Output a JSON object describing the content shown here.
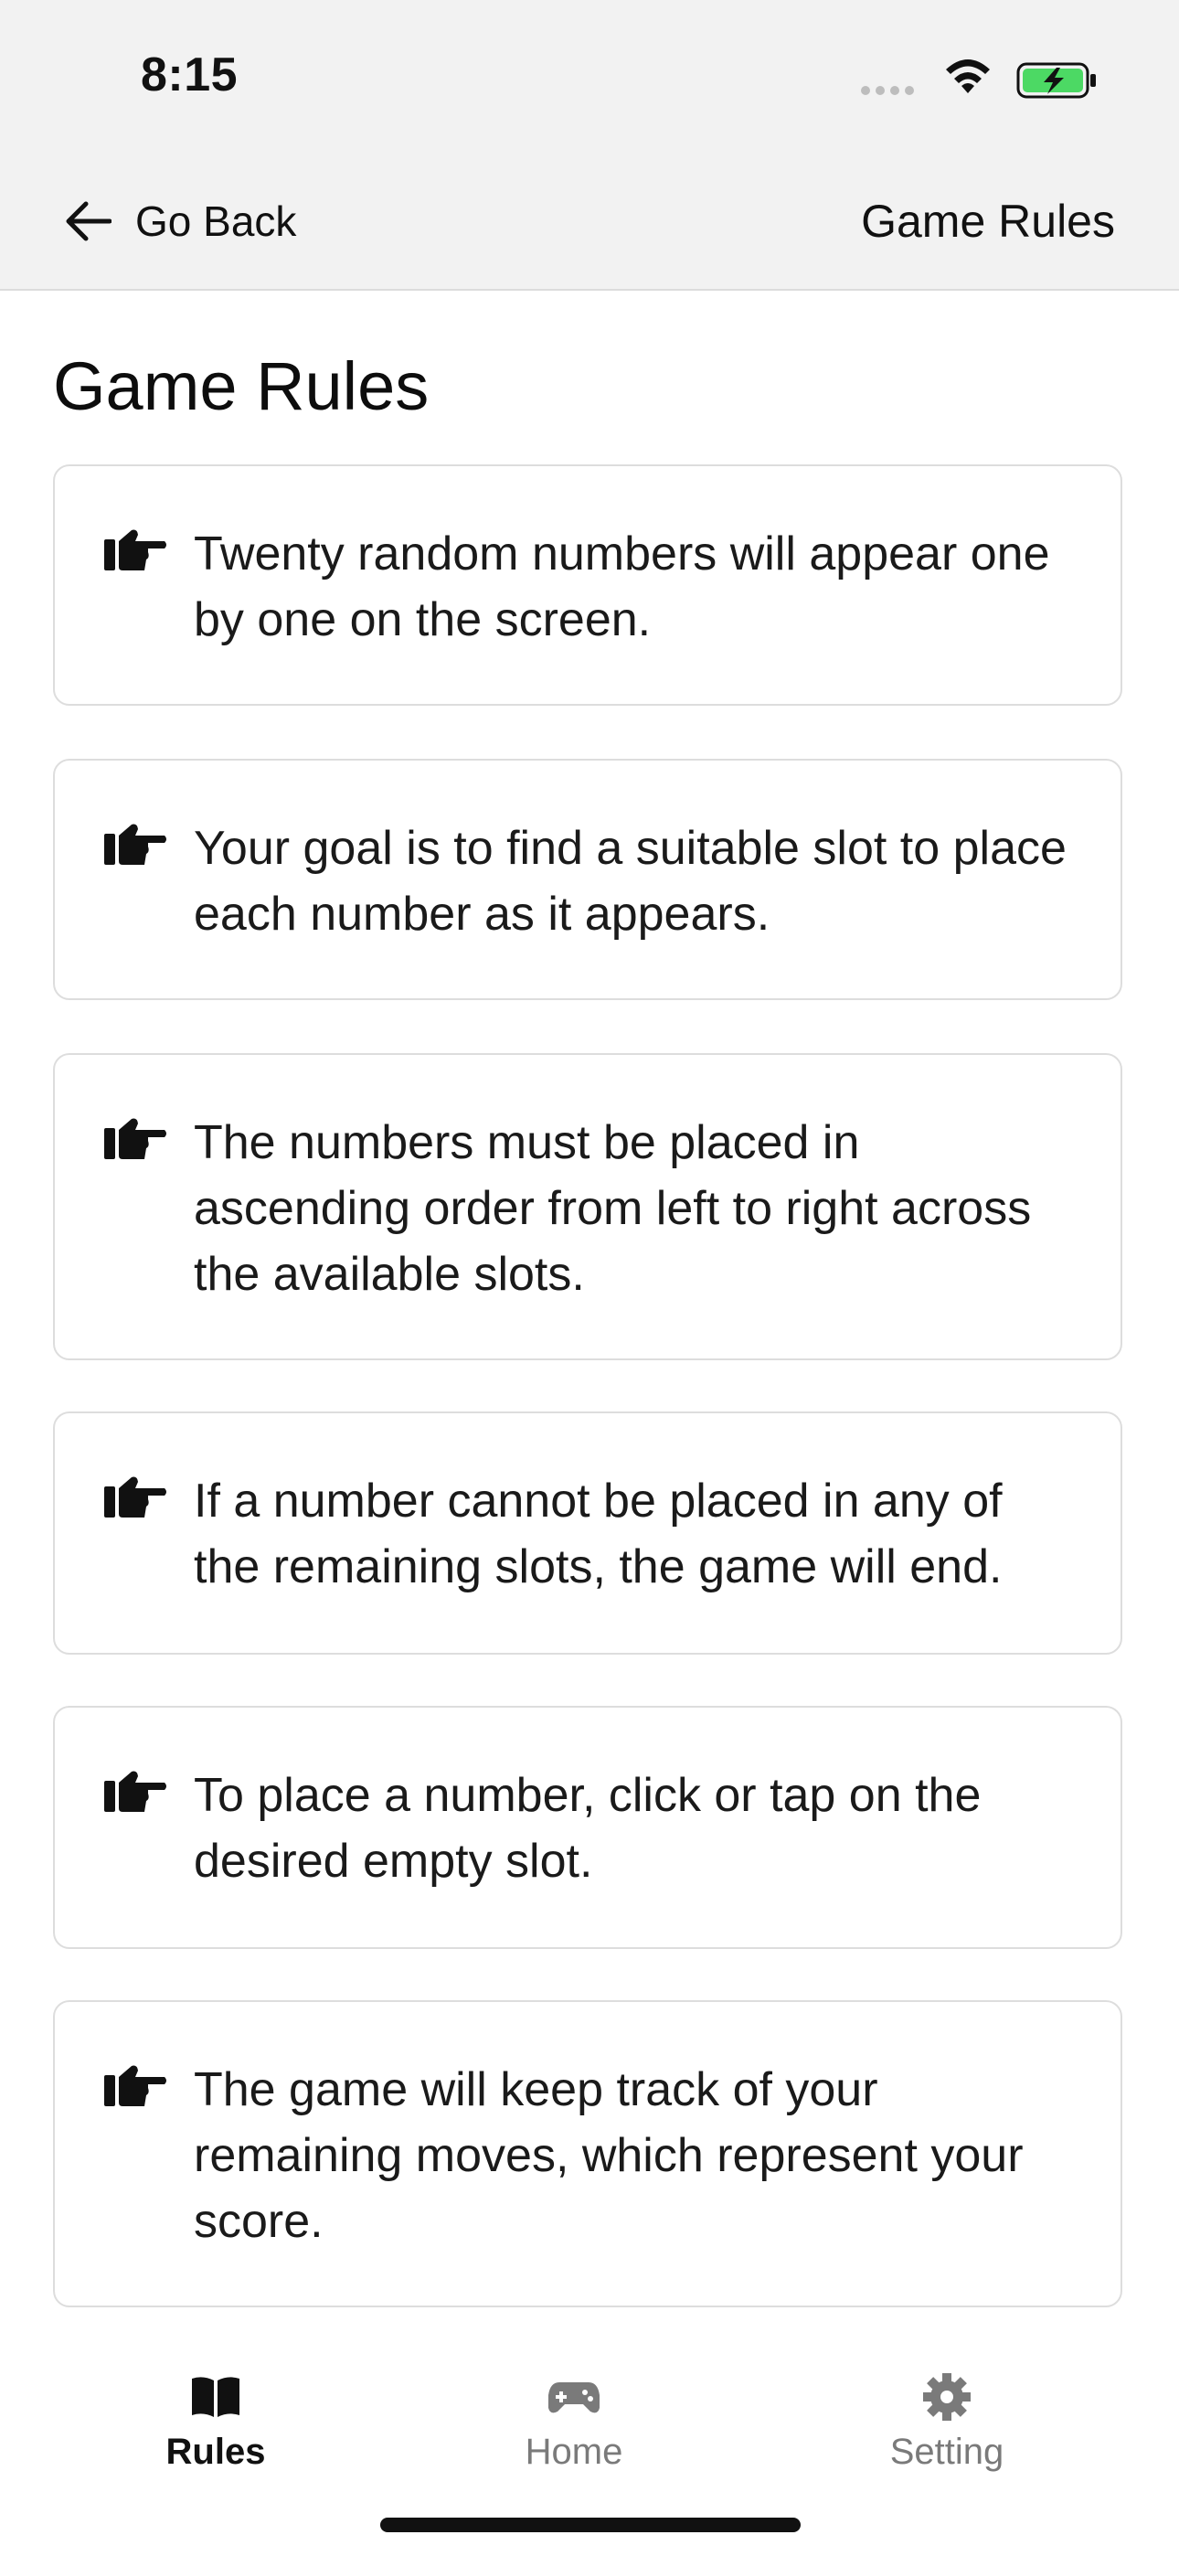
{
  "status_bar": {
    "time": "8:15",
    "battery_color": "#4cd964"
  },
  "nav": {
    "back_label": "Go Back",
    "title": "Game Rules"
  },
  "page": {
    "title": "Game Rules"
  },
  "rules": [
    "Twenty random numbers will appear one by one on the screen.",
    "Your goal is to find a suitable slot to place each number as it appears.",
    "The numbers must be placed in ascending order from left to right across the available slots.",
    "If a number cannot be placed in any of the remaining slots, the game will end.",
    "To place a number, click or tap on the desired empty slot.",
    "The game will keep track of your remaining moves, which represent your score."
  ],
  "tab_bar": {
    "tabs": [
      {
        "label": "Rules",
        "icon": "book-icon",
        "active": true
      },
      {
        "label": "Home",
        "icon": "gamepad-icon",
        "active": false
      },
      {
        "label": "Setting",
        "icon": "gear-icon",
        "active": false
      }
    ]
  }
}
